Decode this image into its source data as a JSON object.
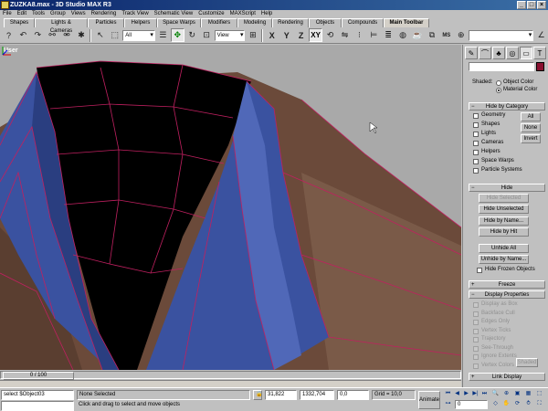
{
  "window": {
    "title": "ZUZKA8.max - 3D Studio MAX R3"
  },
  "menu": [
    "File",
    "Edit",
    "Tools",
    "Group",
    "Views",
    "Rendering",
    "Track View",
    "Schematic View",
    "Customize",
    "MAXScript",
    "Help"
  ],
  "tabs": [
    {
      "label": "Shapes",
      "w": 34
    },
    {
      "label": "Lights & Cameras",
      "w": 58
    },
    {
      "label": "Particles",
      "w": 40
    },
    {
      "label": "Helpers",
      "w": 36
    },
    {
      "label": "Space Warps",
      "w": 48
    },
    {
      "label": "Modifiers",
      "w": 40
    },
    {
      "label": "Modeling",
      "w": 38
    },
    {
      "label": "Rendering",
      "w": 40
    },
    {
      "label": "Objects",
      "w": 36
    },
    {
      "label": "Compounds",
      "w": 46
    },
    {
      "label": "Main Toolbar",
      "w": 50
    }
  ],
  "toolbar": {
    "selection_filter": "All",
    "ref_coord": "View",
    "axis_x": "X",
    "axis_y": "Y",
    "axis_z": "Z",
    "axis_xy": "XY",
    "named_sel_placeholder": ""
  },
  "viewport": {
    "label": "User"
  },
  "display_panel": {
    "shaded_label": "Shaded:",
    "object_color": "Object Color",
    "material_color": "Material Color",
    "material_color_selected": true,
    "hide_by_category": {
      "title": "Hide by Category",
      "items": [
        "Geometry",
        "Shapes",
        "Lights",
        "Cameras",
        "Helpers",
        "Space Warps",
        "Particle Systems"
      ],
      "btn_all": "All",
      "btn_none": "None",
      "btn_invert": "Invert"
    },
    "hide": {
      "title": "Hide",
      "hide_selected": "Hide Selected",
      "hide_unselected": "Hide Unselected",
      "hide_by_name": "Hide by Name...",
      "hide_by_hit": "Hide by Hit",
      "unhide_all": "Unhide All",
      "unhide_by_name": "Unhide by Name...",
      "hide_frozen": "Hide Frozen Objects"
    },
    "freeze": {
      "title": "Freeze"
    },
    "display_properties": {
      "title": "Display Properties",
      "items": [
        "Display as Box",
        "Backface Cull",
        "Edges Only",
        "Vertex Ticks",
        "Trajectory",
        "See-Through",
        "Ignore Extents",
        "Vertex Colors"
      ],
      "shaded_btn": "Shaded"
    },
    "link_display": {
      "title": "Link Display"
    }
  },
  "timeslider": {
    "label": "0 / 100"
  },
  "status": {
    "script_line": "select $Object03",
    "selection": "None Selected",
    "prompt": "Click and drag to select and move objects",
    "x": "31,822",
    "y": "1332,704",
    "z": "0,0",
    "grid": "Grid = 10,0",
    "animate": "Animate",
    "frame": "0"
  },
  "colors": {
    "viewport_bg": "#a9a9a9",
    "jacket_blue": "#3a52a0",
    "wire": "#c02060",
    "fabric": "#6b4a3a",
    "swatch": "#8a1030"
  }
}
